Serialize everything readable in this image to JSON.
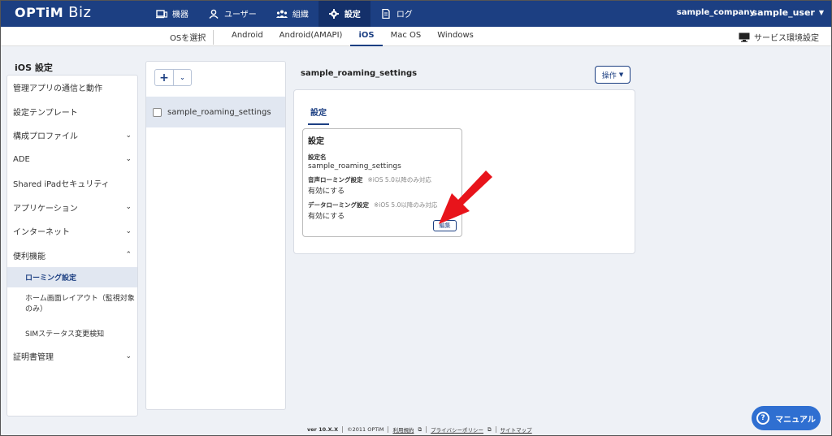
{
  "header": {
    "logo": "OPTiM",
    "logo_sub": "Biz",
    "nav": [
      {
        "label": "機器",
        "icon": "device-icon"
      },
      {
        "label": "ユーザー",
        "icon": "user-icon"
      },
      {
        "label": "組織",
        "icon": "organization-icon"
      },
      {
        "label": "設定",
        "icon": "gear-icon"
      },
      {
        "label": "ログ",
        "icon": "log-icon"
      }
    ],
    "active_nav": "設定",
    "company": "sample_company",
    "user": "sample_user"
  },
  "os_bar": {
    "select_label": "OSを選択",
    "tabs": [
      "Android",
      "Android(AMAPI)",
      "iOS",
      "Mac OS",
      "Windows"
    ],
    "active": "iOS",
    "service_settings": "サービス環境設定"
  },
  "sidebar": {
    "title": "iOS 設定",
    "items": [
      {
        "label": "管理アプリの通信と動作",
        "chevron": ""
      },
      {
        "label": "設定テンプレート",
        "chevron": ""
      },
      {
        "label": "構成プロファイル",
        "chevron": "down"
      },
      {
        "label": "ADE",
        "chevron": "down"
      },
      {
        "label": "Shared iPadセキュリティ",
        "chevron": ""
      },
      {
        "label": "アプリケーション",
        "chevron": "down"
      },
      {
        "label": "インターネット",
        "chevron": "down"
      },
      {
        "label": "便利機能",
        "chevron": "up"
      }
    ],
    "sub_items": [
      "ローミング設定",
      "ホーム画面レイアウト（監視対象のみ）",
      "SIMステータス変更検知"
    ],
    "last_item": "証明書管理"
  },
  "list": {
    "add_button": "+",
    "dropdown_button": "⌄",
    "rows": [
      "sample_roaming_settings"
    ]
  },
  "detail": {
    "title": "sample_roaming_settings",
    "action_button": "操作",
    "tab": "設定",
    "card_title": "設定",
    "fields": [
      {
        "label": "設定名",
        "note": "",
        "value": "sample_roaming_settings"
      },
      {
        "label": "音声ローミング設定",
        "note": "※iOS 5.0以降のみ対応",
        "value": "有効にする"
      },
      {
        "label": "データローミング設定",
        "note": "※iOS 5.0以降のみ対応",
        "value": "有効にする"
      }
    ],
    "edit_button": "編集"
  },
  "footer": {
    "version": "ver 10.X.X",
    "copyright": "©2011 OPTiM",
    "links": [
      "利用規約",
      "プライバシーポリシー",
      "サイトマップ"
    ]
  },
  "manual_button": "マニュアル",
  "colors": {
    "brand": "#1c3f82",
    "accent_arrow": "#e8141b",
    "manual": "#2f6fd1"
  }
}
